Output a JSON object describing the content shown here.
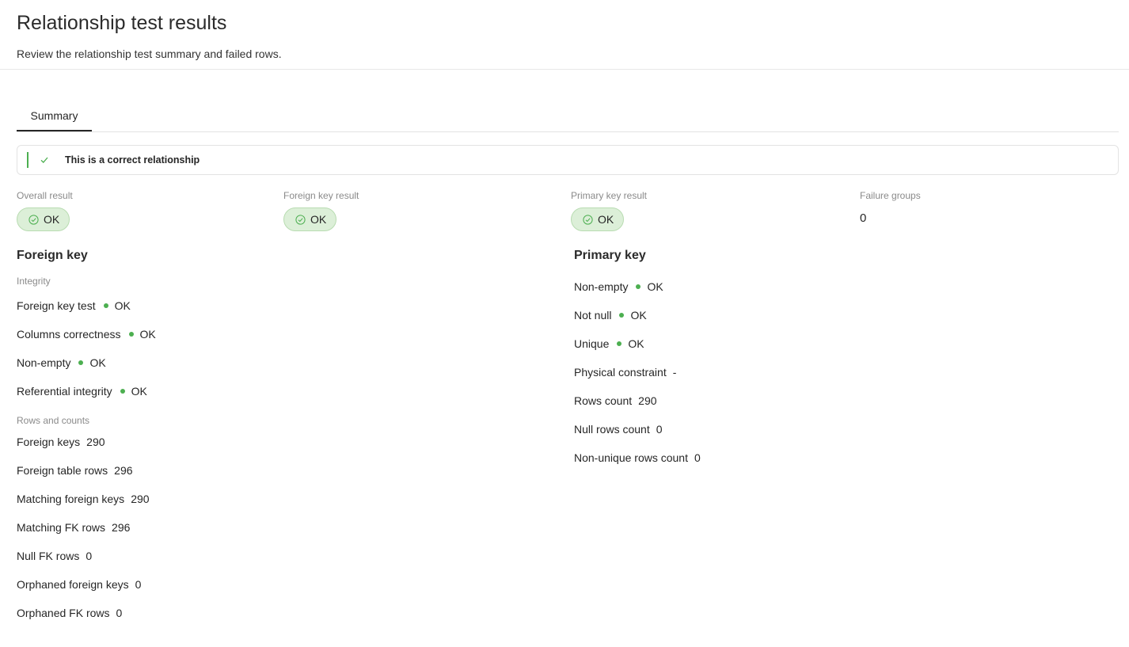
{
  "header": {
    "title": "Relationship test results",
    "subtitle": "Review the relationship test summary and failed rows."
  },
  "tabs": [
    {
      "label": "Summary"
    }
  ],
  "alert": {
    "text": "This is a correct relationship"
  },
  "stats": {
    "overall": {
      "label": "Overall result",
      "value": "OK"
    },
    "foreign": {
      "label": "Foreign key result",
      "value": "OK"
    },
    "primary": {
      "label": "Primary key result",
      "value": "OK"
    },
    "failures": {
      "label": "Failure groups",
      "value": "0"
    }
  },
  "foreign_key": {
    "title": "Foreign key",
    "integrity_label": "Integrity",
    "integrity": [
      {
        "label": "Foreign key test",
        "status": "OK"
      },
      {
        "label": "Columns correctness",
        "status": "OK"
      },
      {
        "label": "Non-empty",
        "status": "OK"
      },
      {
        "label": "Referential integrity",
        "status": "OK"
      }
    ],
    "counts_label": "Rows and counts",
    "counts": [
      {
        "label": "Foreign keys",
        "value": "290"
      },
      {
        "label": "Foreign table rows",
        "value": "296"
      },
      {
        "label": "Matching foreign keys",
        "value": "290"
      },
      {
        "label": "Matching FK rows",
        "value": "296"
      },
      {
        "label": "Null FK rows",
        "value": "0"
      },
      {
        "label": "Orphaned foreign keys",
        "value": "0"
      },
      {
        "label": "Orphaned FK rows",
        "value": "0"
      }
    ]
  },
  "primary_key": {
    "title": "Primary key",
    "checks": [
      {
        "label": "Non-empty",
        "status": "OK"
      },
      {
        "label": "Not null",
        "status": "OK"
      },
      {
        "label": "Unique",
        "status": "OK"
      }
    ],
    "values": [
      {
        "label": "Physical constraint",
        "value": "-"
      },
      {
        "label": "Rows count",
        "value": "290"
      },
      {
        "label": "Null rows count",
        "value": "0"
      },
      {
        "label": "Non-unique rows count",
        "value": "0"
      }
    ]
  },
  "colors": {
    "ok": "#4caf50",
    "badge_bg": "#dcefd8"
  }
}
